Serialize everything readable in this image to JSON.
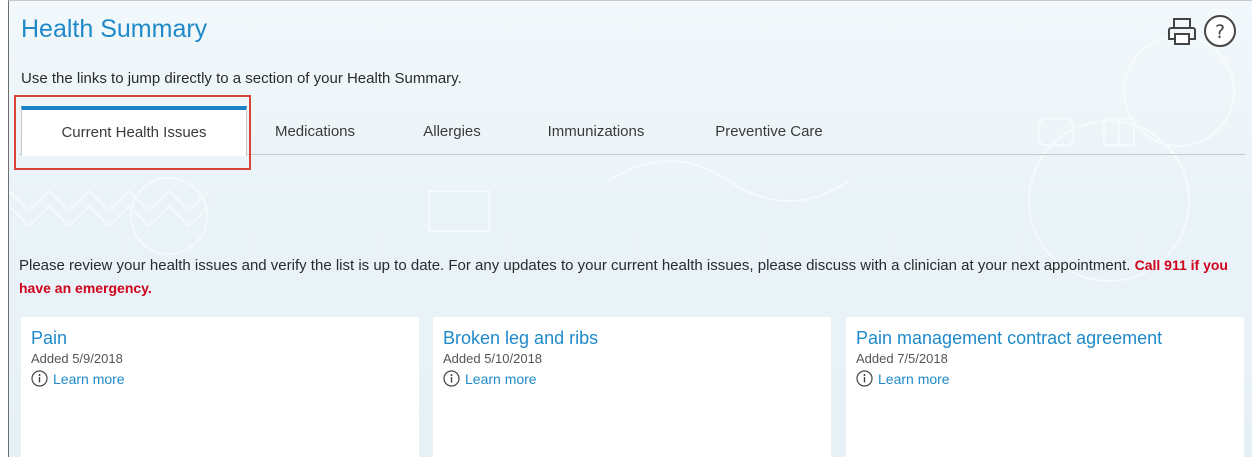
{
  "page": {
    "title": "Health Summary",
    "intro": "Use the links to jump directly to a section of your Health Summary.",
    "icons": [
      "printer-icon",
      "help-icon"
    ]
  },
  "tabs": [
    {
      "label": "Current Health Issues",
      "active": true
    },
    {
      "label": "Medications",
      "active": false
    },
    {
      "label": "Allergies",
      "active": false
    },
    {
      "label": "Immunizations",
      "active": false
    },
    {
      "label": "Preventive Care",
      "active": false
    }
  ],
  "notice": {
    "text": "Please review your health issues and verify the list is up to date. For any updates to your current health issues, please discuss with a clinician at your next appointment. ",
    "emergency": "Call 911 if you have an emergency."
  },
  "issues": [
    {
      "title": "Pain",
      "added": "Added 5/9/2018",
      "link": "Learn more"
    },
    {
      "title": "Broken leg and ribs",
      "added": "Added 5/10/2018",
      "link": "Learn more"
    },
    {
      "title": "Pain management contract agreement",
      "added": "Added 7/5/2018",
      "link": "Learn more"
    }
  ],
  "colors": {
    "accent": "#1f8ac9",
    "active_tab_bar": "#1b82c4",
    "highlight": "#d9443a",
    "emergency": "#d0021b",
    "background": "#eaf3f8"
  }
}
